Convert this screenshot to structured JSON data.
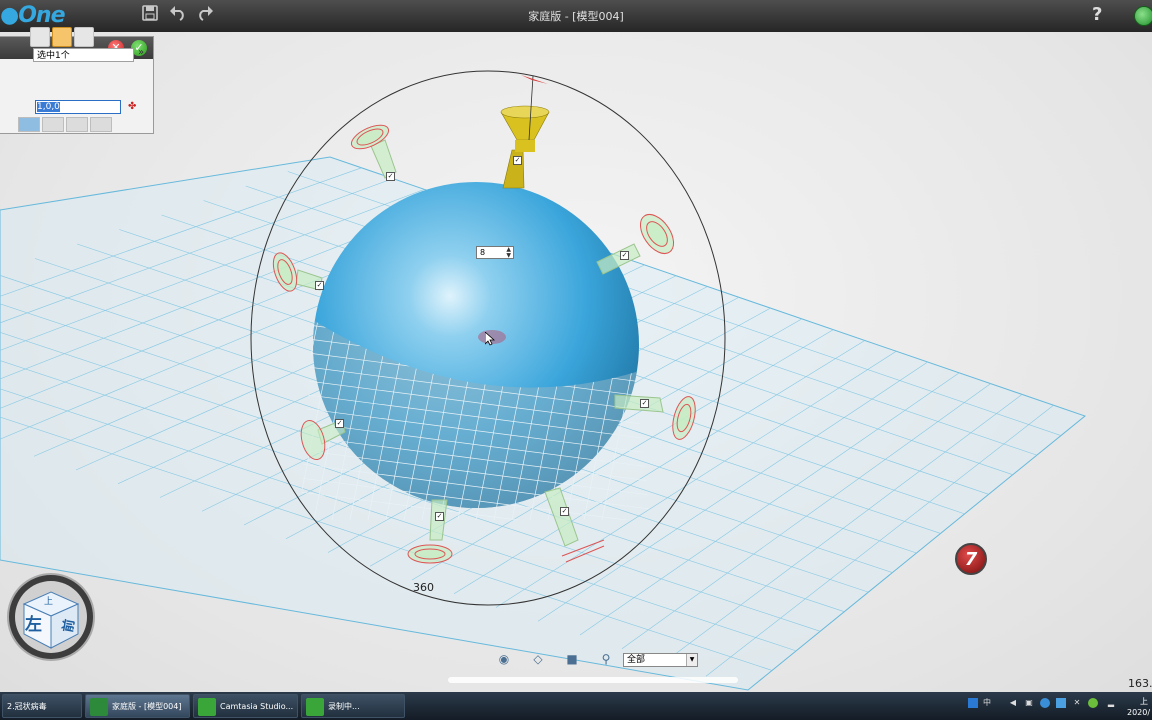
{
  "app": {
    "logo": "One",
    "window_title": "家庭版 - [模型004]",
    "help_label": "?"
  },
  "toolbar": {
    "save_icon": "save-icon",
    "undo_icon": "undo-icon",
    "redo_icon": "redo-icon"
  },
  "panel": {
    "cancel_label": "✕",
    "confirm_label": "✓",
    "selection_text": "选中1个",
    "value_text": "1,0,0"
  },
  "viewport": {
    "count_value": "8",
    "angle_label": "360",
    "nav_cube_left": "左",
    "nav_cube_front": "前",
    "nav_cube_top": "上",
    "badge_number": "7"
  },
  "viewbar": {
    "filter_value": "全部"
  },
  "status": {
    "coordinate_text": "163."
  },
  "taskbar": {
    "items": [
      {
        "label": "2.冠状病毒"
      },
      {
        "label": "家庭版 - [模型004]"
      },
      {
        "label": "Camtasia Studio..."
      },
      {
        "label": "录制中..."
      }
    ],
    "ime_label": "中",
    "clock_time": "上",
    "clock_date": "2020/"
  },
  "colors": {
    "sphere": "#3aa5db",
    "grid": "#79c6e6",
    "accent_spike": "#d9c21f"
  }
}
